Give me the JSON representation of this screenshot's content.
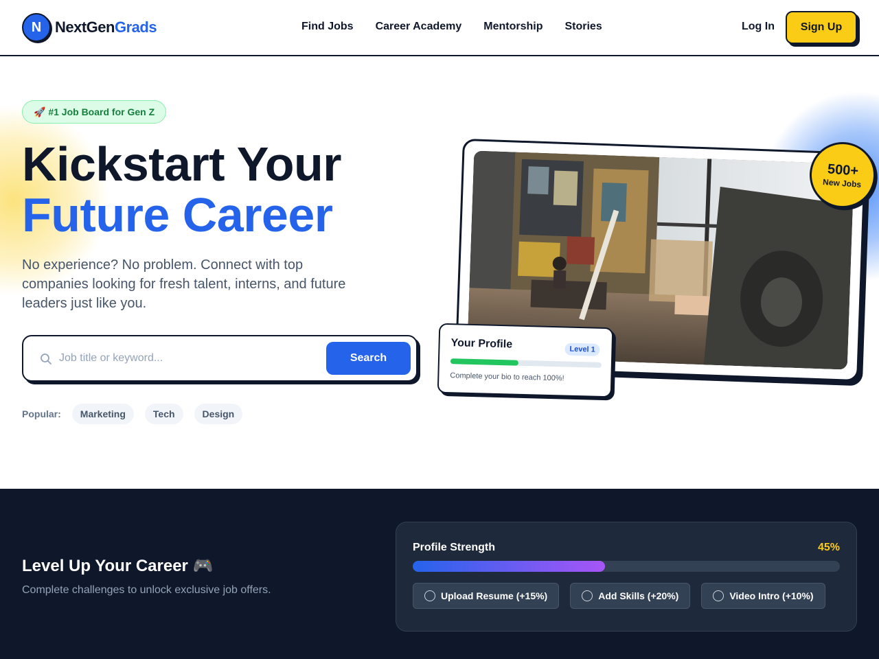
{
  "brand": {
    "mark": "N",
    "name_part1": "NextGen",
    "name_part2": "Grads"
  },
  "nav": {
    "items": [
      "Find Jobs",
      "Career Academy",
      "Mentorship",
      "Stories"
    ]
  },
  "auth": {
    "login_label": "Log In",
    "signup_label": "Sign Up"
  },
  "hero": {
    "badge": "🚀 #1 Job Board for Gen Z",
    "title_line1": "Kickstart Your",
    "title_line2": "Future Career",
    "subtitle": "No experience? No problem. Connect with top companies looking for fresh talent, interns, and future leaders just like you.",
    "search": {
      "placeholder": "Job title or keyword...",
      "button_label": "Search",
      "icon": "search-icon"
    },
    "popular": {
      "label": "Popular:",
      "tags": [
        "Marketing",
        "Tech",
        "Design"
      ]
    }
  },
  "showcase": {
    "stat_value": "500+",
    "stat_label": "New Jobs",
    "profile_card": {
      "title": "Your Profile",
      "level": "Level 1",
      "progress": 0.45,
      "note": "Complete your bio to reach 100%!"
    }
  },
  "gamify": {
    "title": "Level Up Your Career 🎮",
    "subtitle": "Complete challenges to unlock exclusive job offers.",
    "strength": {
      "title": "Profile Strength",
      "percent_label": "45%",
      "percent": 45,
      "tasks": [
        "Upload Resume (+15%)",
        "Add Skills (+20%)",
        "Video Intro (+10%)"
      ]
    }
  },
  "colors": {
    "primary": "#2563eb",
    "accent": "#facc15",
    "dark": "#0f172a",
    "success": "#22c55e"
  }
}
